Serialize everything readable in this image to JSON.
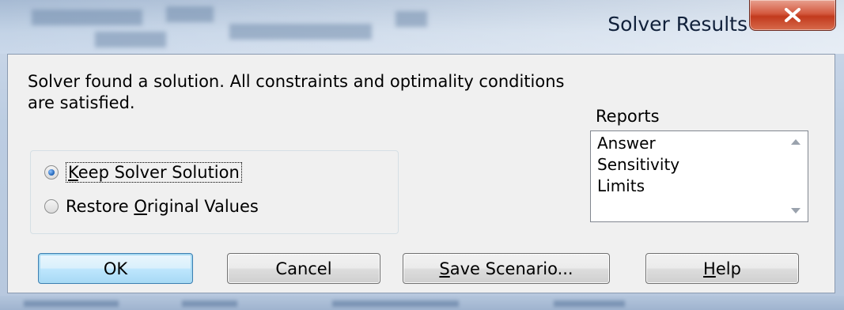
{
  "window": {
    "title": "Solver Results",
    "close_label": "X"
  },
  "message": "Solver found a solution.  All constraints and optimality conditions are satisfied.",
  "options": {
    "keep_label_mnemonic": "K",
    "keep_label_rest": "eep Solver Solution",
    "keep_selected": true,
    "restore_label_before": "Restore ",
    "restore_label_mnemonic": "O",
    "restore_label_after": "riginal Values",
    "restore_selected": false
  },
  "reports": {
    "label": "Reports",
    "items": [
      "Answer",
      "Sensitivity",
      "Limits"
    ]
  },
  "buttons": {
    "ok": "OK",
    "cancel": "Cancel",
    "save_mnemonic": "S",
    "save_rest": "ave Scenario...",
    "help_mnemonic": "H",
    "help_rest": "elp"
  },
  "colors": {
    "client_bg": "#f0f0f0",
    "default_button_border": "#3c7fb1",
    "close_button": "#c23a1d"
  }
}
